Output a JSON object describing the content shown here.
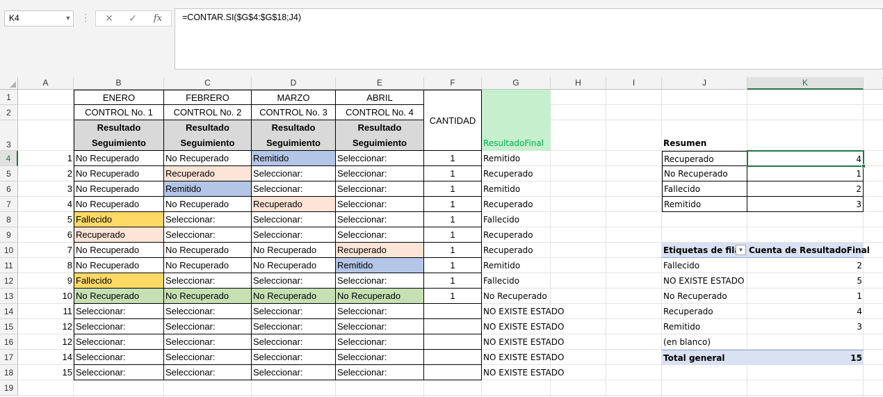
{
  "formula_bar": {
    "name_box": "K4",
    "formula": "=CONTAR.SI($G$4:$G$18;J4)",
    "cancel_icon": "✕",
    "enter_icon": "✓",
    "fx_icon": "fx"
  },
  "columns": [
    "A",
    "B",
    "C",
    "D",
    "E",
    "F",
    "G",
    "H",
    "I",
    "J",
    "K"
  ],
  "rows": [
    "1",
    "2",
    "3",
    "4",
    "5",
    "6",
    "7",
    "8",
    "9",
    "10",
    "11",
    "12",
    "13",
    "14",
    "15",
    "16",
    "17",
    "18",
    "19"
  ],
  "table": {
    "months": [
      "ENERO",
      "FEBRERO",
      "MARZO",
      "ABRIL"
    ],
    "controls": [
      "CONTROL No. 1",
      "CONTROL No. 2",
      "CONTROL No. 3",
      "CONTROL No. 4"
    ],
    "result_line1": "Resultado",
    "result_line2": "Seguimiento",
    "cantidad_header": "CANTIDAD",
    "resultado_final_header": "ResultadoFinal",
    "rows": [
      {
        "n": "1",
        "b": "No Recuperado",
        "c": "No Recuperado",
        "d": "Remitido",
        "e": "Seleccionar:",
        "f": "1",
        "g": "Remitido"
      },
      {
        "n": "2",
        "b": "No Recuperado",
        "c": "Recuperado",
        "d": "Seleccionar:",
        "e": "Seleccionar:",
        "f": "1",
        "g": "Recuperado"
      },
      {
        "n": "3",
        "b": "No Recuperado",
        "c": "Remitido",
        "d": "Seleccionar:",
        "e": "Seleccionar:",
        "f": "1",
        "g": "Remitido"
      },
      {
        "n": "4",
        "b": "No Recuperado",
        "c": "No Recuperado",
        "d": "Recuperado",
        "e": "Seleccionar:",
        "f": "1",
        "g": "Recuperado"
      },
      {
        "n": "5",
        "b": "Fallecido",
        "c": "Seleccionar:",
        "d": "Seleccionar:",
        "e": "Seleccionar:",
        "f": "1",
        "g": "Fallecido"
      },
      {
        "n": "6",
        "b": "Recuperado",
        "c": "Seleccionar:",
        "d": "Seleccionar:",
        "e": "Seleccionar:",
        "f": "1",
        "g": "Recuperado"
      },
      {
        "n": "7",
        "b": "No Recuperado",
        "c": "No Recuperado",
        "d": "No Recuperado",
        "e": "Recuperado",
        "f": "1",
        "g": "Recuperado"
      },
      {
        "n": "8",
        "b": "No Recuperado",
        "c": "No Recuperado",
        "d": "No Recuperado",
        "e": "Remitido",
        "f": "1",
        "g": "Remitido"
      },
      {
        "n": "9",
        "b": "Fallecido",
        "c": "Seleccionar:",
        "d": "Seleccionar:",
        "e": "Seleccionar:",
        "f": "1",
        "g": "Fallecido"
      },
      {
        "n": "10",
        "b": "No Recuperado",
        "c": "No Recuperado",
        "d": "No Recuperado",
        "e": "No Recuperado",
        "f": "1",
        "g": "No Recuperado"
      },
      {
        "n": "11",
        "b": "Seleccionar:",
        "c": "Seleccionar:",
        "d": "Seleccionar:",
        "e": "Seleccionar:",
        "f": "",
        "g": "NO EXISTE ESTADO"
      },
      {
        "n": "12",
        "b": "Seleccionar:",
        "c": "Seleccionar:",
        "d": "Seleccionar:",
        "e": "Seleccionar:",
        "f": "",
        "g": "NO EXISTE ESTADO"
      },
      {
        "n": "12",
        "b": "Seleccionar:",
        "c": "Seleccionar:",
        "d": "Seleccionar:",
        "e": "Seleccionar:",
        "f": "",
        "g": "NO EXISTE ESTADO"
      },
      {
        "n": "14",
        "b": "Seleccionar:",
        "c": "Seleccionar:",
        "d": "Seleccionar:",
        "e": "Seleccionar:",
        "f": "",
        "g": "NO EXISTE ESTADO"
      },
      {
        "n": "15",
        "b": "Seleccionar:",
        "c": "Seleccionar:",
        "d": "Seleccionar:",
        "e": "Seleccionar:",
        "f": "",
        "g": "NO EXISTE ESTADO"
      }
    ]
  },
  "resumen": {
    "title": "Resumen",
    "rows": [
      {
        "label": "Recuperado",
        "value": "4"
      },
      {
        "label": "No Recuperado",
        "value": "1"
      },
      {
        "label": "Fallecido",
        "value": "2"
      },
      {
        "label": "Remitido",
        "value": "3"
      }
    ]
  },
  "pivot": {
    "row_labels_header": "Etiquetas de fila",
    "count_header": "Cuenta de ResultadoFinal",
    "rows": [
      {
        "label": "Fallecido",
        "value": "2"
      },
      {
        "label": "NO EXISTE ESTADO",
        "value": "5"
      },
      {
        "label": "No Recuperado",
        "value": "1"
      },
      {
        "label": "Recuperado",
        "value": "4"
      },
      {
        "label": "Remitido",
        "value": "3"
      },
      {
        "label": "(en blanco)",
        "value": ""
      }
    ],
    "total_label": "Total general",
    "total_value": "15"
  },
  "colors": {
    "fallecido": "#ffd966",
    "recuperado": "#fce4d6",
    "remitido": "#b4c6e7",
    "no_recuperado_row10": "#c6e0b4",
    "resultado_final_header": "#c6efce",
    "resultado_final_text": "#00b050",
    "pivot_header": "#d9e1f2",
    "selection": "#217346"
  }
}
